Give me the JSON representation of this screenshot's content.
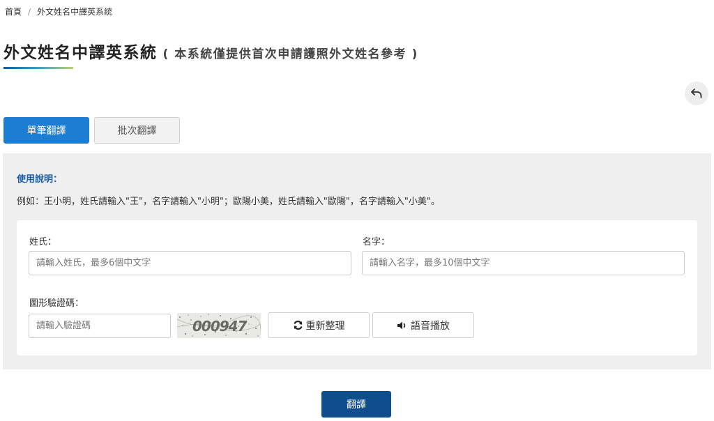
{
  "breadcrumb": {
    "home": "首頁",
    "separator": "/",
    "current": "外文姓名中譯英系統"
  },
  "page": {
    "title": "外文姓名中譯英系統",
    "subtitle": "( 本系統僅提供首次申請護照外文姓名參考 )"
  },
  "tabs": [
    {
      "label": "單筆翻譯",
      "active": true
    },
    {
      "label": "批次翻譯",
      "active": false
    }
  ],
  "usage": {
    "title": "使用說明：",
    "text": "例如：王小明，姓氏請輸入\"王\"，名字請輸入\"小明\"；歐陽小美，姓氏請輸入\"歐陽\"，名字請輸入\"小美\"。"
  },
  "form": {
    "surname_label": "姓氏：",
    "surname_placeholder": "請輸入姓氏，最多6個中文字",
    "surname_value": "",
    "givenname_label": "名字：",
    "givenname_placeholder": "請輸入名字，最多10個中文字",
    "givenname_value": "",
    "captcha_label": "圖形驗證碼：",
    "captcha_placeholder": "請輸入驗證碼",
    "captcha_value": "",
    "captcha_image_text": "000947",
    "refresh_label": "重新整理",
    "audio_label": "語音播放"
  },
  "submit_label": "翻譯",
  "colors": {
    "primary": "#1d7dd2",
    "submit": "#0f4d8c",
    "panel_bg": "#efefef",
    "usage_title": "#1e5fa8"
  },
  "icons": {
    "back": "undo-arrow-icon",
    "refresh": "refresh-icon",
    "audio": "speaker-icon"
  }
}
